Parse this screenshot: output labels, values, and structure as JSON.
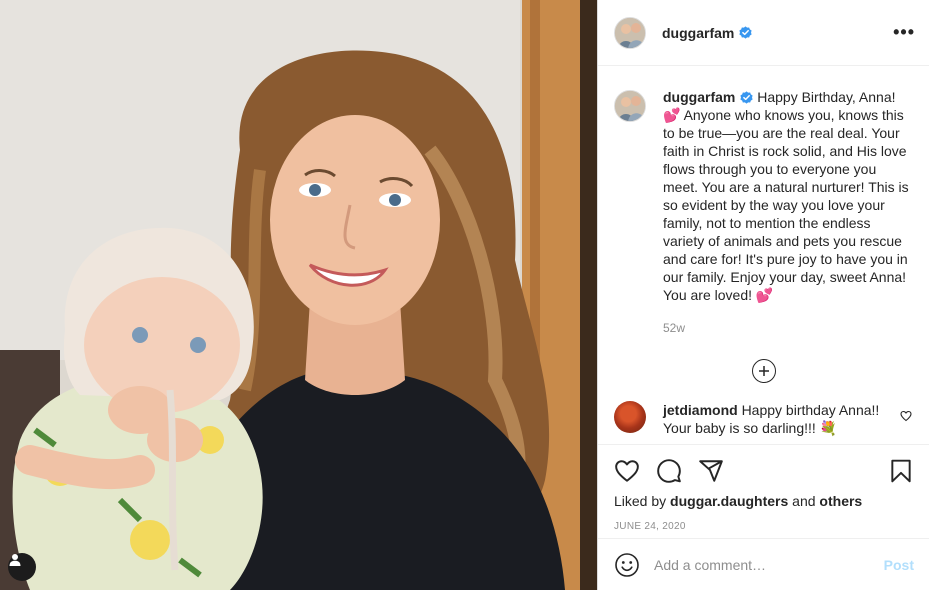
{
  "post": {
    "username": "duggarfam",
    "verified": true,
    "more_label": "•••"
  },
  "caption": {
    "username": "duggarfam",
    "text_before_heart": "Happy Birthday, Anna!",
    "heart_1": "💕",
    "text_main": "Anyone who knows you, knows this to be true—you are the real deal. Your faith in Christ is rock solid, and His love flows through you to everyone you meet. You are a natural nurturer! This is so evident by the way you love your family, not to mention the endless variety of animals and pets you rescue and care for! It's pure joy to have you in our family. Enjoy your day, sweet Anna! You are loved!",
    "heart_2": "💕",
    "time_ago": "52w"
  },
  "comments": [
    {
      "username": "jetdiamond",
      "text": "Happy birthday Anna!! Your baby is so darling!!! 💐"
    }
  ],
  "engagement": {
    "liked_by_prefix": "Liked by",
    "liked_by_user": "duggar.daughters",
    "liked_by_and": "and",
    "liked_by_others": "others",
    "date": "JUNE 24, 2020"
  },
  "add_comment": {
    "placeholder": "Add a comment…",
    "post_label": "Post"
  },
  "icons": {
    "like": "heart-icon",
    "comment": "comment-bubble-icon",
    "share": "paper-plane-icon",
    "save": "bookmark-icon",
    "emoji": "smiley-icon",
    "load_more": "plus-circle-icon",
    "tag": "person-icon",
    "verified": "verified-badge-icon"
  },
  "colors": {
    "verified_blue": "#3897f0",
    "post_button_disabled": "#b2dffc",
    "heart_pink": "#e6007e",
    "muted_text": "#8e8e8e"
  }
}
